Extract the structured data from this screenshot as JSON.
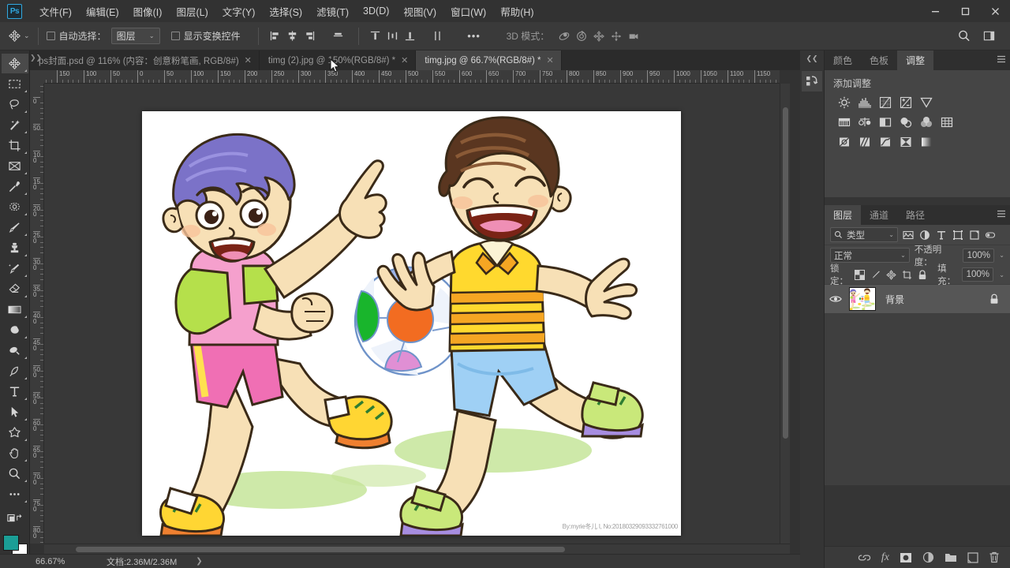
{
  "app": {
    "name": "Ps",
    "logo_color": "#31a8e0"
  },
  "menubar": {
    "items": [
      {
        "label": "文件(F)",
        "name": "menu-file"
      },
      {
        "label": "编辑(E)",
        "name": "menu-edit"
      },
      {
        "label": "图像(I)",
        "name": "menu-image"
      },
      {
        "label": "图层(L)",
        "name": "menu-layer"
      },
      {
        "label": "文字(Y)",
        "name": "menu-type"
      },
      {
        "label": "选择(S)",
        "name": "menu-select"
      },
      {
        "label": "滤镜(T)",
        "name": "menu-filter"
      },
      {
        "label": "3D(D)",
        "name": "menu-3d"
      },
      {
        "label": "视图(V)",
        "name": "menu-view"
      },
      {
        "label": "窗口(W)",
        "name": "menu-window"
      },
      {
        "label": "帮助(H)",
        "name": "menu-help"
      }
    ]
  },
  "window_controls": {
    "minimize": "—",
    "maximize": "□",
    "close": "✕"
  },
  "options_bar": {
    "tool_icon": "move-tool-icon",
    "auto_select_checked": false,
    "auto_select_label": "自动选择：",
    "auto_select_value": "图层",
    "show_transform_checked": false,
    "show_transform_label": "显示变换控件",
    "more_label": "•••",
    "mode_3d_label": "3D 模式：",
    "search_icon": "search-icon",
    "workspace_icon": "workspace-icon"
  },
  "toolbar": {
    "tools": [
      {
        "name": "move-tool",
        "active": true
      },
      {
        "name": "marquee-tool",
        "active": false
      },
      {
        "name": "lasso-tool",
        "active": false
      },
      {
        "name": "magic-wand-tool",
        "active": false
      },
      {
        "name": "crop-tool",
        "active": false
      },
      {
        "name": "frame-tool",
        "active": false
      },
      {
        "name": "eyedropper-tool",
        "active": false
      },
      {
        "name": "healing-brush-tool",
        "active": false
      },
      {
        "name": "brush-tool",
        "active": false
      },
      {
        "name": "clone-stamp-tool",
        "active": false
      },
      {
        "name": "history-brush-tool",
        "active": false
      },
      {
        "name": "eraser-tool",
        "active": false
      },
      {
        "name": "gradient-tool",
        "active": false
      },
      {
        "name": "blur-tool",
        "active": false
      },
      {
        "name": "dodge-tool",
        "active": false
      },
      {
        "name": "pen-tool",
        "active": false
      },
      {
        "name": "type-tool",
        "active": false
      },
      {
        "name": "path-selection-tool",
        "active": false
      },
      {
        "name": "shape-tool",
        "active": false
      },
      {
        "name": "hand-tool",
        "active": false
      },
      {
        "name": "zoom-tool",
        "active": false
      },
      {
        "name": "edit-toolbar",
        "active": false
      }
    ],
    "foreground_color": "#1b9e96",
    "background_color": "#ffffff"
  },
  "document_tabs": [
    {
      "label": "ps封面.psd @ 116% (内容：创意粉笔画, RGB/8#)",
      "active": false,
      "close": "✕"
    },
    {
      "label": "timg (2).jpg @ 150%(RGB/8#) *",
      "active": false,
      "close": "✕"
    },
    {
      "label": "timg.jpg @ 66.7%(RGB/8#) *",
      "active": true,
      "close": "✕"
    }
  ],
  "rulers": {
    "h_ticks": [
      "00",
      "150",
      "100",
      "50",
      "0",
      "50",
      "100",
      "150",
      "200",
      "250",
      "300",
      "350",
      "400",
      "450",
      "500",
      "550",
      "600",
      "650",
      "700",
      "750",
      "800",
      "850",
      "900",
      "950",
      "1000",
      "1050",
      "1100",
      "1150",
      "1"
    ],
    "v_ticks": [
      "50",
      "0",
      "50",
      "100",
      "150",
      "200",
      "250",
      "300",
      "350",
      "400",
      "450",
      "500",
      "550",
      "600",
      "650",
      "700",
      "750",
      "800"
    ]
  },
  "canvas": {
    "watermark": "By:myrie冬儿 I, No:20180329093332761000",
    "ball": {
      "base": "#ffffff",
      "center": "#f26c21",
      "left": "#19b52c",
      "top": "#9cb3e6",
      "bottom": "#e08fd4"
    },
    "boy_left": {
      "hair": "#7b72c8",
      "shirt": "#f5a0cd",
      "sleeve": "#b5e04b",
      "shorts": "#f06fb4",
      "shoe": "#ffd633",
      "skin": "#f7e0b6"
    },
    "boy_right": {
      "hair": "#5a3620",
      "shirt": "#ffd92e",
      "stripe": "#f5a623",
      "shorts": "#9fd0f5",
      "shoe": "#c9e87a",
      "skin": "#f7e0b6"
    },
    "ground_shadow": "#c6e59a"
  },
  "status_bar": {
    "zoom": "66.67%",
    "doc_label": "文档:2.36M/2.36M",
    "arrow": "❯"
  },
  "panel_rail": {
    "collapse": "❮❮",
    "icon": "history-actions-icon"
  },
  "adjustments_panel": {
    "tabs": [
      {
        "label": "颜色",
        "active": false
      },
      {
        "label": "色板",
        "active": false
      },
      {
        "label": "调整",
        "active": true
      }
    ],
    "menu_icon": "panel-menu-icon",
    "title": "添加调整",
    "row1": [
      "brightness-contrast-icon",
      "levels-icon",
      "curves-icon",
      "exposure-icon",
      "vibrance-icon"
    ],
    "row2": [
      "hue-saturation-icon",
      "color-balance-icon",
      "black-white-icon",
      "photo-filter-icon",
      "channel-mixer-icon",
      "color-lookup-icon"
    ],
    "row3": [
      "invert-icon",
      "posterize-icon",
      "threshold-icon",
      "selective-color-icon",
      "gradient-map-icon"
    ]
  },
  "layers_panel": {
    "tabs": [
      {
        "label": "图层",
        "active": true
      },
      {
        "label": "通道",
        "active": false
      },
      {
        "label": "路径",
        "active": false
      }
    ],
    "menu_icon": "panel-menu-icon",
    "filter": {
      "search_icon": "search-icon",
      "value": "类型",
      "chevron": "chevron-down-icon",
      "icons": [
        "pixel-filter-icon",
        "adjustment-filter-icon",
        "type-filter-icon",
        "shape-filter-icon",
        "smart-object-filter-icon",
        "toggle-filter-icon"
      ]
    },
    "blend_mode": "正常",
    "opacity_label": "不透明度：",
    "opacity_value": "100%",
    "lock_label": "锁定：",
    "lock_icons": [
      "lock-transparent-icon",
      "lock-image-icon",
      "lock-position-icon",
      "lock-artboard-icon",
      "lock-all-icon"
    ],
    "fill_label": "填充：",
    "fill_value": "100%",
    "layers": [
      {
        "name": "背景",
        "visible": true,
        "locked": true,
        "eye_icon": "eye-icon",
        "lock_icon": "lock-icon"
      }
    ],
    "bottom_icons": [
      "link-layers-icon",
      "layer-style-fx-icon",
      "add-mask-icon",
      "new-adjustment-icon",
      "new-group-icon",
      "new-layer-icon",
      "delete-layer-icon"
    ]
  }
}
